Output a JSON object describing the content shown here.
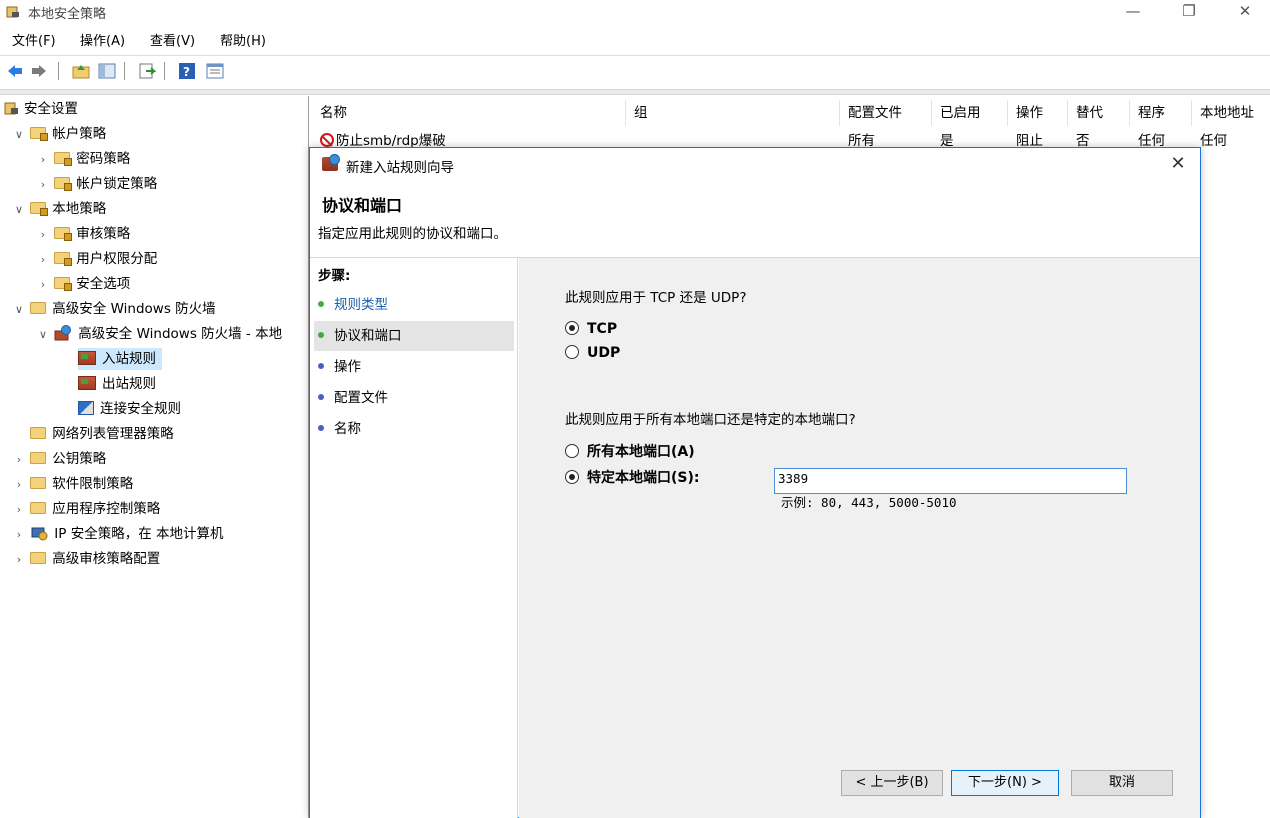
{
  "window": {
    "title": "本地安全策略",
    "min": "—",
    "max": "❐",
    "close": "✕"
  },
  "menu": [
    "文件(F)",
    "操作(A)",
    "查看(V)",
    "帮助(H)"
  ],
  "tree": {
    "root": "安全设置",
    "items": [
      {
        "label": "帐户策略",
        "chev": "∨"
      },
      {
        "label": "密码策略",
        "chev": "›"
      },
      {
        "label": "帐户锁定策略",
        "chev": "›"
      },
      {
        "label": "本地策略",
        "chev": "∨"
      },
      {
        "label": "审核策略",
        "chev": "›"
      },
      {
        "label": "用户权限分配",
        "chev": "›"
      },
      {
        "label": "安全选项",
        "chev": "›"
      },
      {
        "label": "高级安全 Windows 防火墙",
        "chev": "∨"
      },
      {
        "label": "高级安全 Windows 防火墙 - 本地",
        "chev": "∨"
      },
      {
        "label": "入站规则",
        "chev": ""
      },
      {
        "label": "出站规则",
        "chev": ""
      },
      {
        "label": "连接安全规则",
        "chev": ""
      },
      {
        "label": "网络列表管理器策略",
        "chev": ""
      },
      {
        "label": "公钥策略",
        "chev": "›"
      },
      {
        "label": "软件限制策略",
        "chev": "›"
      },
      {
        "label": "应用程序控制策略",
        "chev": "›"
      },
      {
        "label": "IP 安全策略，在 本地计算机",
        "chev": "›"
      },
      {
        "label": "高级审核策略配置",
        "chev": "›"
      }
    ]
  },
  "list": {
    "columns": [
      "名称",
      "组",
      "配置文件",
      "已启用",
      "操作",
      "替代",
      "程序",
      "本地地址"
    ],
    "row": [
      "防止smb/rdp爆破",
      "",
      "所有",
      "是",
      "阻止",
      "否",
      "任何",
      "任何"
    ]
  },
  "dialog": {
    "title": "新建入站规则向导",
    "close": "✕",
    "heading": "协议和端口",
    "subheading": "指定应用此规则的协议和端口。",
    "steps_title": "步骤:",
    "steps": [
      "规则类型",
      "协议和端口",
      "操作",
      "配置文件",
      "名称"
    ],
    "q1": "此规则应用于 TCP 还是 UDP?",
    "proto_tcp": "TCP",
    "proto_udp": "UDP",
    "q2": "此规则应用于所有本地端口还是特定的本地端口?",
    "all_ports": "所有本地端口(A)",
    "specific_ports": "特定本地端口(S):",
    "port_value": "3389",
    "example": "示例: 80, 443, 5000-5010",
    "btn_back": "< 上一步(B)",
    "btn_next": "下一步(N) >",
    "btn_cancel": "取消"
  },
  "colors": {
    "accent": "#0078d7",
    "selected": "#cce8ff",
    "dialog_border": "#1a73d8",
    "link": "#1a5ea8"
  }
}
